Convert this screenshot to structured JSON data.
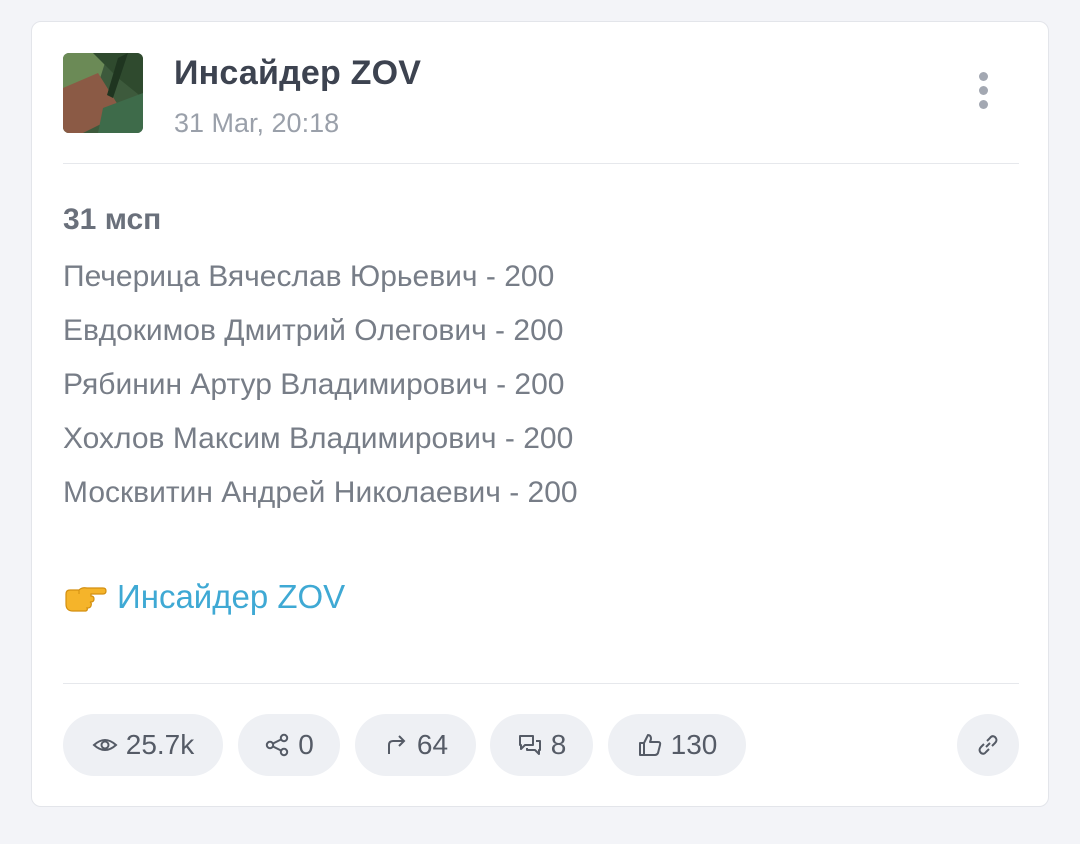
{
  "channel": {
    "name": "Инсайдер ZOV",
    "date": "31 Mar, 20:18"
  },
  "post": {
    "heading": "31 мсп",
    "lines": [
      "Печерица Вячеслав Юрьевич - 200",
      "Евдокимов Дмитрий Олегович - 200",
      "Рябинин Артур Владимирович - 200",
      "Хохлов Максим Владимирович - 200",
      "Москвитин Андрей Николаевич - 200"
    ],
    "link_emoji": "pointing-right-hand",
    "link_text": "Инсайдер ZOV"
  },
  "stats": {
    "views": "25.7k",
    "shares": "0",
    "forwards": "64",
    "comments": "8",
    "likes": "130"
  },
  "colors": {
    "link": "#3fa9d4",
    "pill_bg": "#eef0f4",
    "background": "#f3f4f8"
  }
}
